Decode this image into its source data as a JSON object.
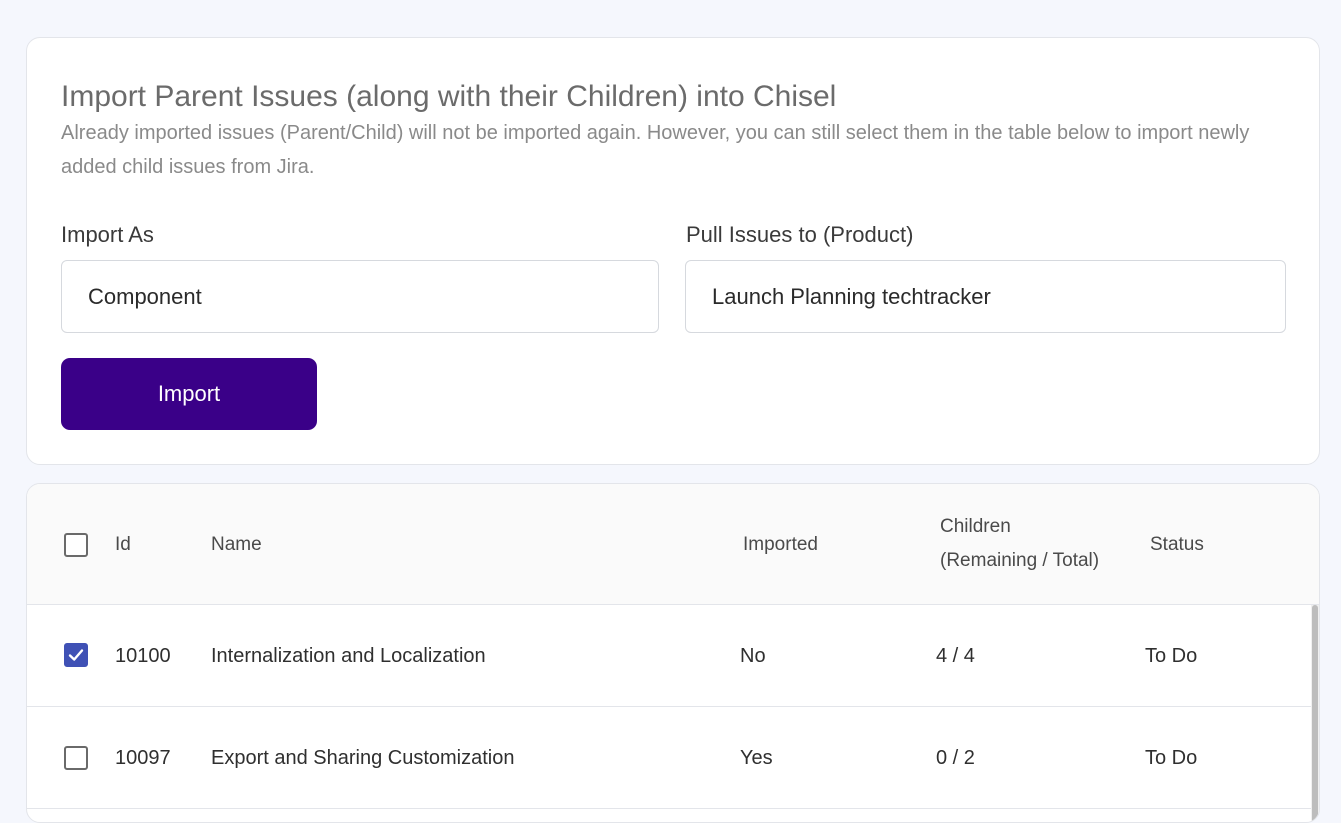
{
  "import_panel": {
    "title": "Import Parent Issues (along with their Children) into Chisel",
    "description": "Already imported issues (Parent/Child) will not be imported again. However, you can still select them in the table below to import newly added child issues from Jira.",
    "import_as_label": "Import As",
    "import_as_value": "Component",
    "pull_to_label": "Pull Issues to (Product)",
    "pull_to_value": "Launch Planning techtracker",
    "import_button": "Import"
  },
  "table": {
    "headers": {
      "id": "Id",
      "name": "Name",
      "imported": "Imported",
      "children_line1": "Children",
      "children_line2": "(Remaining / Total)",
      "status": "Status"
    },
    "rows": [
      {
        "checked": true,
        "id": "10100",
        "name": "Internalization and Localization",
        "imported": "No",
        "children": "4 / 4",
        "status": "To Do"
      },
      {
        "checked": false,
        "id": "10097",
        "name": "Export and Sharing Customization",
        "imported": "Yes",
        "children": "0 / 2",
        "status": "To Do"
      }
    ]
  },
  "colors": {
    "primary_button": "#3a0088",
    "checkbox_checked": "#3f51b5",
    "page_background": "#f5f7fd"
  }
}
